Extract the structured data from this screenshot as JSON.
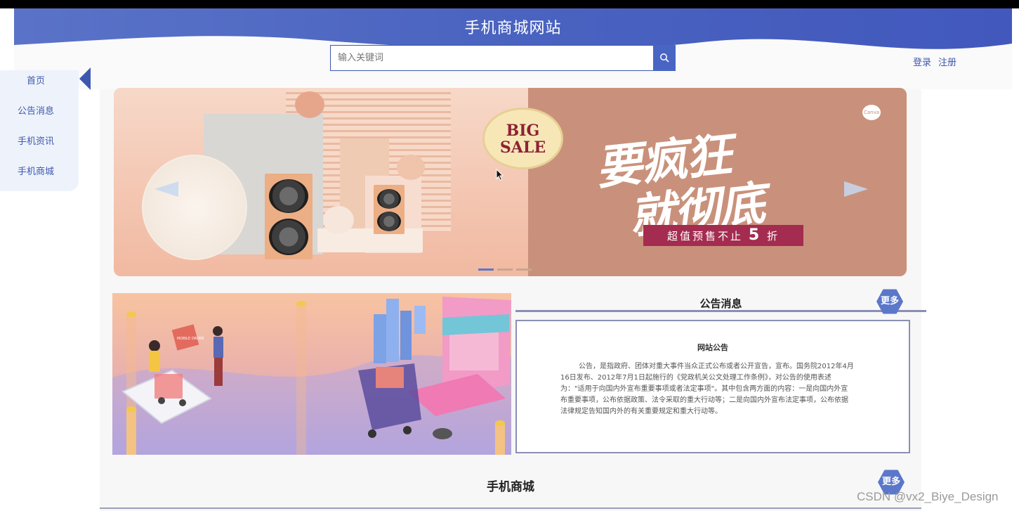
{
  "site": {
    "title": "手机商城网站"
  },
  "search": {
    "placeholder": "输入关键词",
    "icon": "search-icon"
  },
  "auth": {
    "login": "登录",
    "register": "注册"
  },
  "nav": {
    "items": [
      {
        "label": "首页",
        "active": true
      },
      {
        "label": "公告消息"
      },
      {
        "label": "手机资讯"
      },
      {
        "label": "手机商城"
      }
    ]
  },
  "banner": {
    "badge_line1": "BIG",
    "badge_line2": "SALE",
    "headline_line1": "要疯狂",
    "headline_line2": "就彻底",
    "subline_prefix": "超值预售不止",
    "subline_number": "5",
    "subline_suffix": "折",
    "logo": "Canva",
    "slide_count": 3,
    "active_slide": 1
  },
  "notice": {
    "title": "公告消息",
    "more": "更多",
    "box_title": "网站公告",
    "body": "公告，是指政府、团体对重大事件当众正式公布或者公开宣告，宣布。国务院2012年4月16日发布、2012年7月1日起施行的《党政机关公文处理工作条例》，对公告的使用表述为：\"适用于向国内外宣布重要事项或者法定事项\"。其中包含两方面的内容：一是向国内外宣布重要事项，公布依据政策、法令采取的重大行动等；二是向国内外宣布法定事项，公布依据法律规定告知国内外的有关重要规定和重大行动等。"
  },
  "shop": {
    "title": "手机商城",
    "more": "更多"
  },
  "illustration": {
    "sign": "MOBILE ORDER"
  },
  "watermark": "CSDN @vx2_Biye_Design",
  "colors": {
    "primary": "#4965c4",
    "nav_bg": "#eef3fb",
    "text_blue": "#3e58ad",
    "promo_red": "#a42c50"
  }
}
